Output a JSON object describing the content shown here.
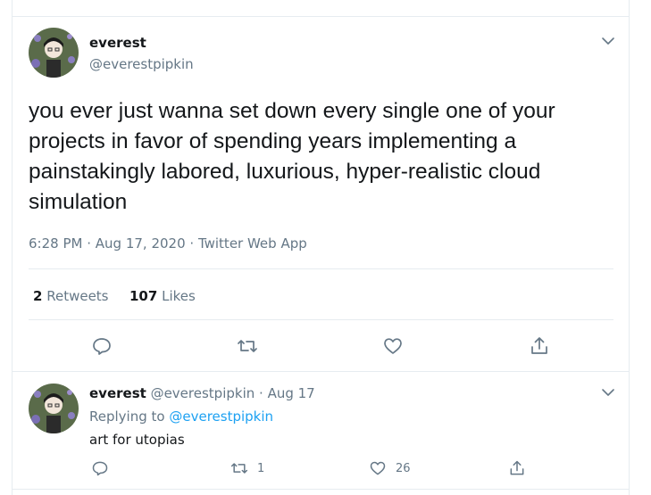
{
  "tweet": {
    "author_name": "everest",
    "author_handle": "@everestpipkin",
    "text": "you ever just wanna set down every single one of your projects in favor of spending years implementing a painstakingly labored, luxurious, hyper-realistic cloud simulation",
    "time": "6:28 PM",
    "date": "Aug 17, 2020",
    "source": "Twitter Web App",
    "dot": " · ",
    "retweets_count": "2",
    "retweets_label": "Retweets",
    "likes_count": "107",
    "likes_label": "Likes",
    "actions": [
      "reply-icon",
      "retweet-icon",
      "like-icon",
      "share-icon"
    ]
  },
  "reply": {
    "author_name": "everest",
    "author_handle": "@everestpipkin",
    "date": "Aug 17",
    "dot": " · ",
    "replying_prefix": "Replying to",
    "replying_to": "@everestpipkin",
    "text": "art for utopias",
    "retweet_count": "1",
    "like_count": "26"
  },
  "colors": {
    "accent": "#1da1f2",
    "text": "#14171a",
    "secondary": "#657786",
    "border": "#e6ecf0"
  }
}
